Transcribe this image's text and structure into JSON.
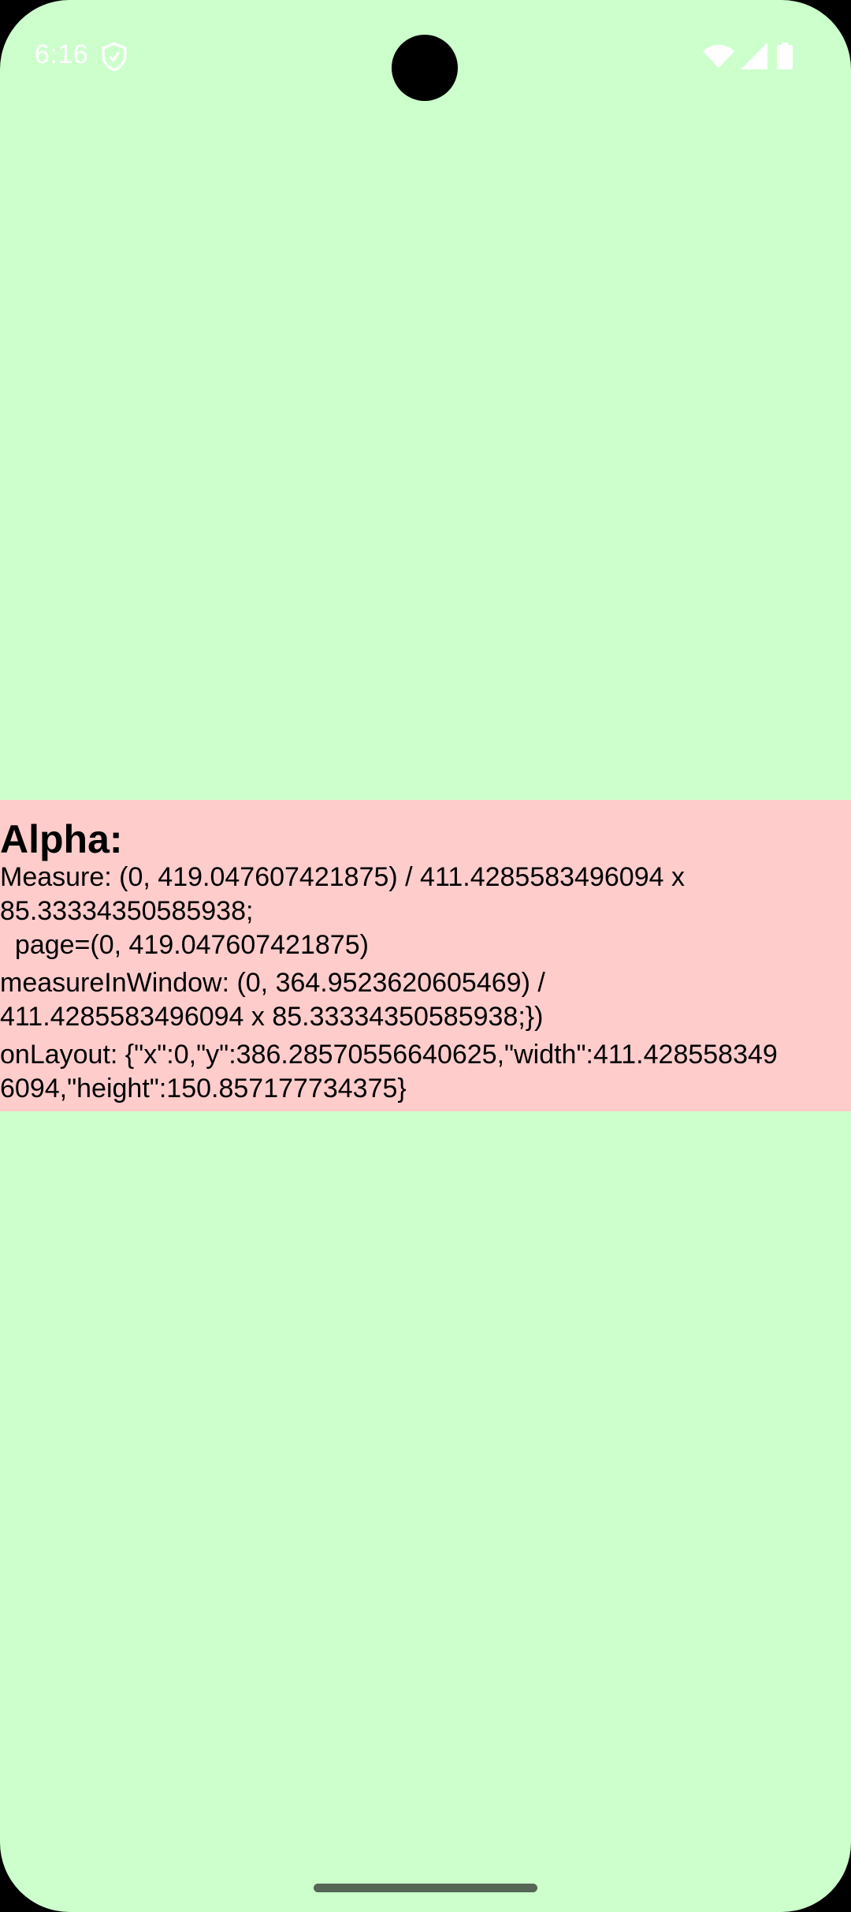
{
  "status_bar": {
    "time": "6:16",
    "icons": [
      "shield-icon",
      "wifi-icon",
      "signal-icon",
      "battery-icon"
    ],
    "text_color": "#ffffff"
  },
  "colors": {
    "background": "#ccffcc",
    "panel": "#ffcccc",
    "text": "#000000"
  },
  "panel": {
    "title": "Alpha:",
    "measure_line_1": "Measure: (0, 419.047607421875) / 411.4285583496094 x",
    "measure_line_2": "85.33334350585938;",
    "measure_line_3": "  page=(0, 419.047607421875)",
    "window_line_1": "measureInWindow: (0, 364.9523620605469) /",
    "window_line_2": "411.4285583496094 x 85.33334350585938;})",
    "layout_line_1": "onLayout: {\"x\":0,\"y\":386.28570556640625,\"width\":411.428558349",
    "layout_line_2": "6094,\"height\":150.857177734375}"
  }
}
